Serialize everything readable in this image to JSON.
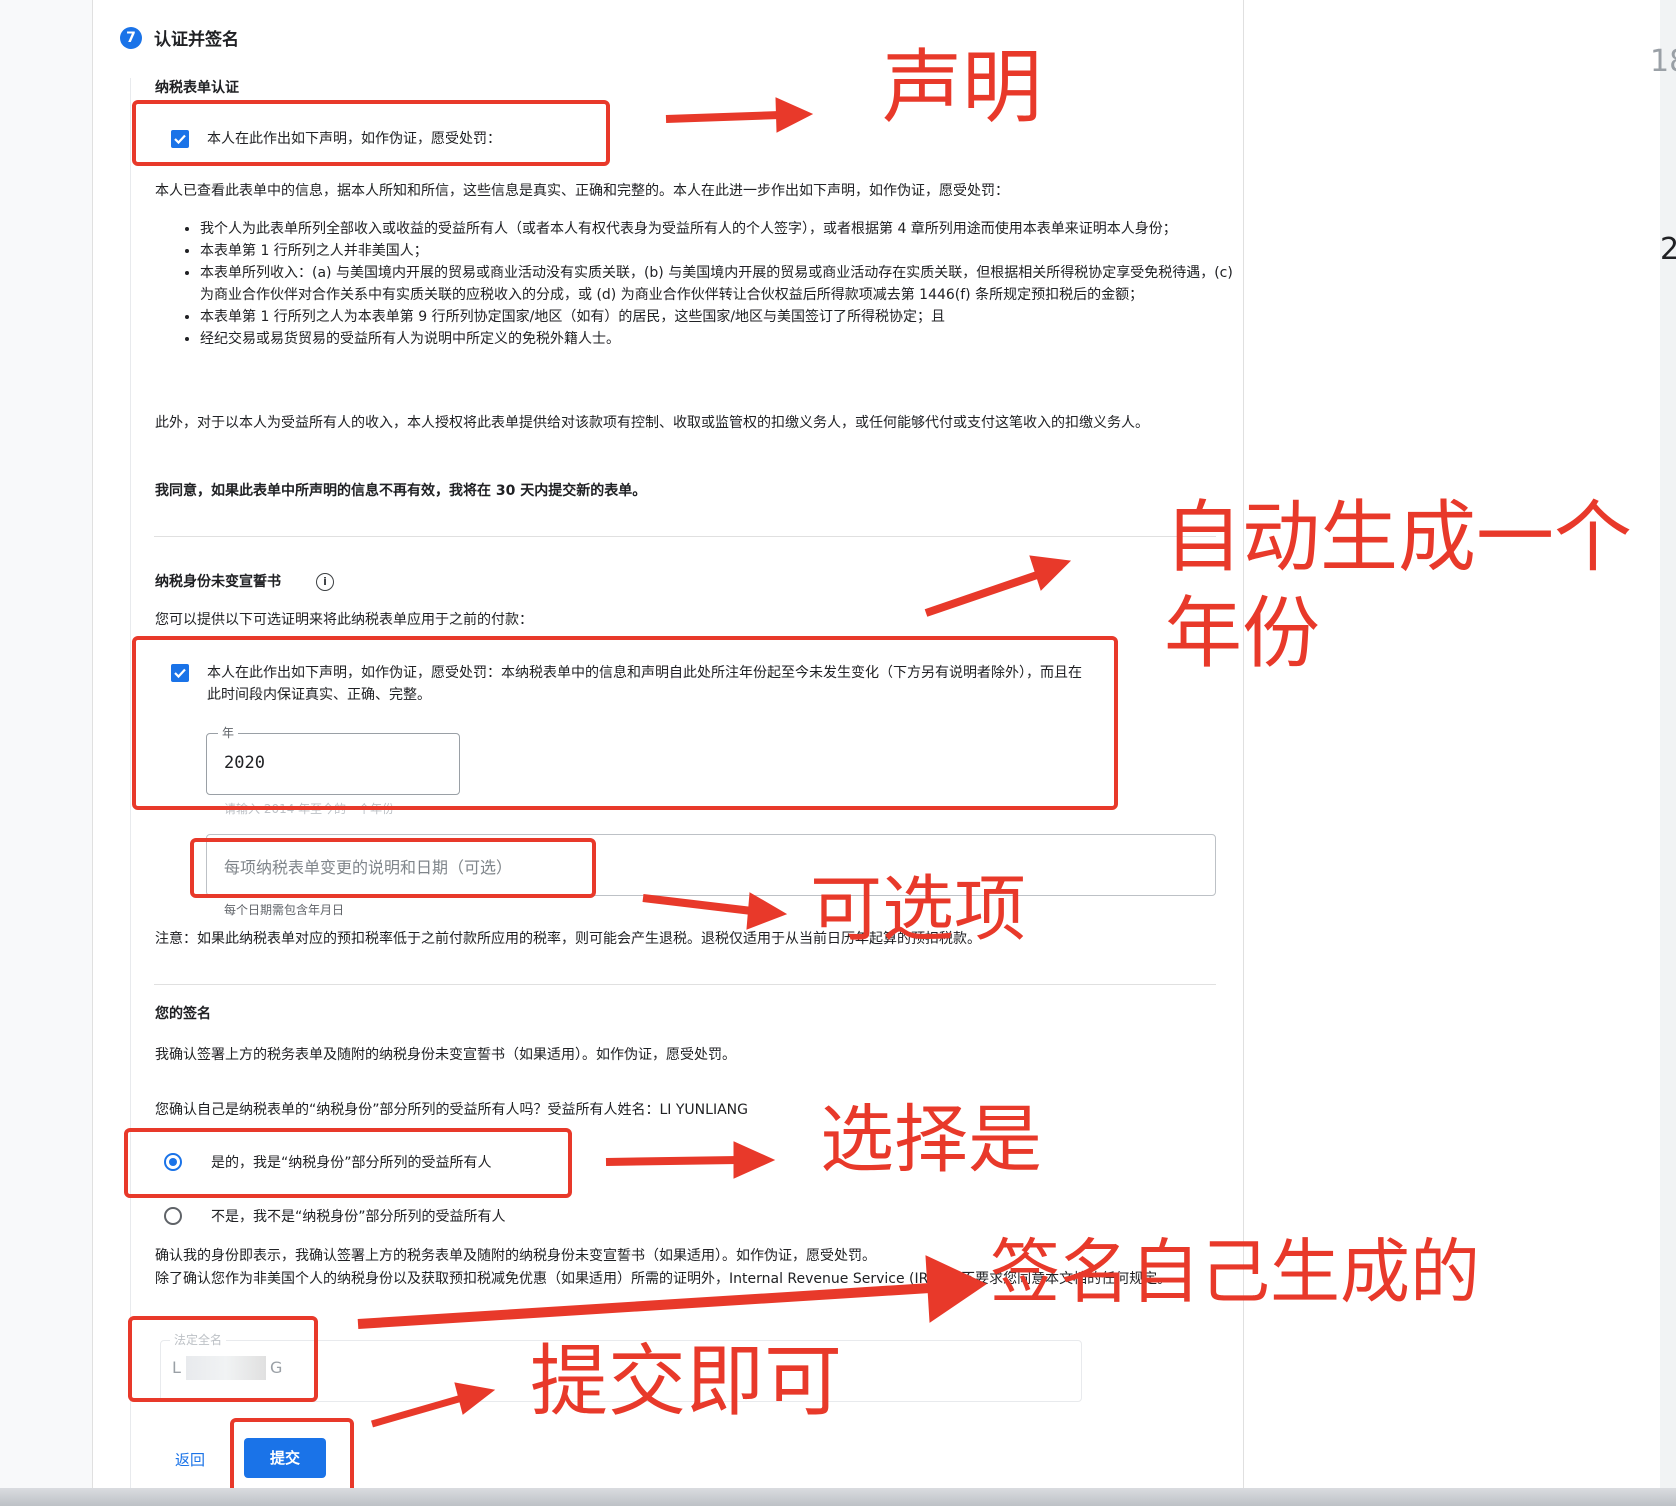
{
  "step": {
    "number": "7",
    "title": "认证并签名"
  },
  "tax_form_certification": {
    "heading": "纳税表单认证",
    "checkbox_label": "本人在此作出如下声明，如作伪证，愿受处罚：",
    "intro": "本人已查看此表单中的信息，据本人所知和所信，这些信息是真实、正确和完整的。本人在此进一步作出如下声明，如作伪证，愿受处罚：",
    "bullets": [
      "我个人为此表单所列全部收入或收益的受益所有人（或者本人有权代表身为受益所有人的个人签字），或者根据第 4 章所列用途而使用本表单来证明本人身份；",
      "本表单第 1 行所列之人并非美国人；",
      "本表单所列收入：(a) 与美国境内开展的贸易或商业活动没有实质关联，(b) 与美国境内开展的贸易或商业活动存在实质关联，但根据相关所得税协定享受免税待遇，(c) 为商业合作伙伴对合作关系中有实质关联的应税收入的分成，或 (d) 为商业合作伙伴转让合伙权益后所得款项减去第 1446(f) 条所规定预扣税后的金额；",
      "本表单第 1 行所列之人为本表单第 9 行所列协定国家/地区（如有）的居民，这些国家/地区与美国签订了所得税协定；且",
      "经纪交易或易货贸易的受益所有人为说明中所定义的免税外籍人士。"
    ],
    "authorization": "此外，对于以本人为受益所有人的收入，本人授权将此表单提供给对该款项有控制、收取或监管权的扣缴义务人，或任何能够代付或支付这笔收入的扣缴义务人。",
    "agreement": "我同意，如果此表单中所声明的信息不再有效，我将在 30 天内提交新的表单。"
  },
  "unchanged_status": {
    "heading": "纳税身份未变宣誓书",
    "info_icon": "info-icon",
    "intro": "您可以提供以下可选证明来将此纳税表单应用于之前的付款：",
    "checkbox_label": "本人在此作出如下声明，如作伪证，愿受处罚：本纳税表单中的信息和声明自此处所注年份起至今未发生变化（下方另有说明者除外），而且在此时间段内保证真实、正确、完整。",
    "year_label": "年",
    "year_value": "2020",
    "year_helper": "请输入 2014 年至今的一个年份",
    "desc_placeholder": "每项纳税表单变更的说明和日期（可选）",
    "desc_helper": "每个日期需包含年月日",
    "note": "注意：如果此纳税表单对应的预扣税率低于之前付款所应用的税率，则可能会产生退税。退税仅适用于从当前日历年起算的预扣税款。"
  },
  "signature": {
    "heading": "您的签名",
    "confirm": "我确认签署上方的税务表单及随附的纳税身份未变宣誓书（如果适用）。如作伪证，愿受处罚。",
    "question": "您确认自己是纳税表单的“纳税身份”部分所列的受益所有人吗？受益所有人姓名：LI YUNLIANG",
    "options": [
      "是的，我是“纳税身份”部分所列的受益所有人",
      "不是，我不是“纳税身份”部分所列的受益所有人"
    ],
    "selected_index": 0,
    "identity_note_1": "确认我的身份即表示，我确认签署上方的税务表单及随附的纳税身份未变宣誓书（如果适用）。如作伪证，愿受处罚。",
    "identity_note_2": "除了确认您作为非美国个人的纳税身份以及获取预扣税减免优惠（如果适用）所需的证明外，Internal Revenue Service (IRS) 并不要求您同意本文档的任何规定。",
    "name_label": "法定全名",
    "name_value_start": "L",
    "name_value_end": "G"
  },
  "actions": {
    "back": "返回",
    "submit": "提交"
  },
  "annotations": {
    "declaration": "声明",
    "auto_year_line1": "自动生成一个",
    "auto_year_line2": "年份",
    "optional": "可选项",
    "choose_yes": "选择是",
    "signature_auto": "签名自己生成的",
    "submit_done": "提交即可",
    "color": "#e8392a"
  },
  "edge_chars": {
    "top": "18",
    "mid": "2"
  }
}
